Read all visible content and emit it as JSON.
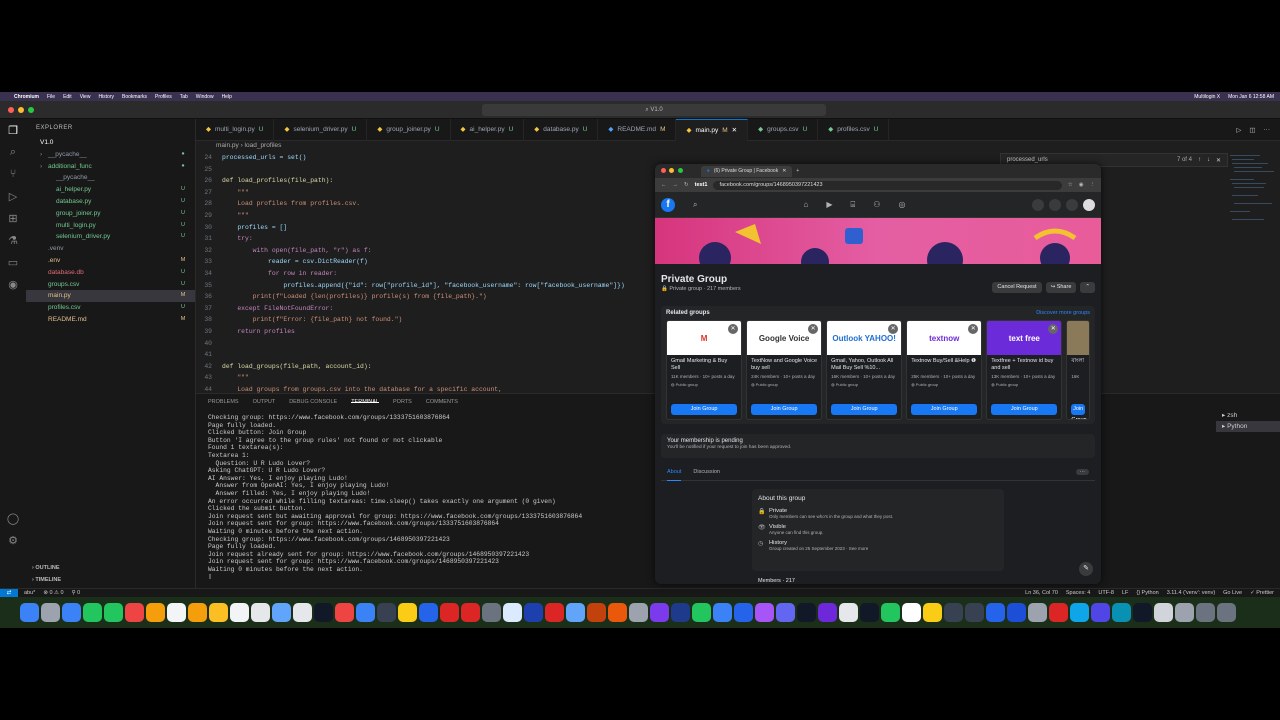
{
  "menubar": {
    "app": "Chromium",
    "items": [
      "File",
      "Edit",
      "View",
      "History",
      "Bookmarks",
      "Profiles",
      "Tab",
      "Window",
      "Help"
    ],
    "right": [
      "Multilogin X",
      "Mon Jan 6  12:58 AM"
    ]
  },
  "vscode": {
    "command_center": "V1.0",
    "explorer_title": "EXPLORER",
    "tree": [
      {
        "name": "V1.0",
        "indent": 0,
        "color": "#ffffff",
        "flag": "",
        "flag_color": "#888"
      },
      {
        "name": "__pycache__",
        "indent": 1,
        "color": "#8e9aa8",
        "flag": "●",
        "flag_color": "#73c991"
      },
      {
        "name": "additional_func",
        "indent": 1,
        "color": "#73c991",
        "flag": "●",
        "flag_color": "#73c991"
      },
      {
        "name": "__pycache__",
        "indent": 2,
        "color": "#8e9aa8",
        "flag": "",
        "flag_color": "#888"
      },
      {
        "name": "ai_helper.py",
        "indent": 2,
        "color": "#73c991",
        "flag": "U",
        "flag_color": "#73c991"
      },
      {
        "name": "database.py",
        "indent": 2,
        "color": "#73c991",
        "flag": "U",
        "flag_color": "#73c991"
      },
      {
        "name": "group_joiner.py",
        "indent": 2,
        "color": "#73c991",
        "flag": "U",
        "flag_color": "#73c991"
      },
      {
        "name": "multi_login.py",
        "indent": 2,
        "color": "#73c991",
        "flag": "U",
        "flag_color": "#73c991"
      },
      {
        "name": "selenium_driver.py",
        "indent": 2,
        "color": "#73c991",
        "flag": "U",
        "flag_color": "#73c991"
      },
      {
        "name": ".venv",
        "indent": 1,
        "color": "#8e9aa8",
        "flag": "",
        "flag_color": "#888"
      },
      {
        "name": ".env",
        "indent": 1,
        "color": "#e2c08d",
        "flag": "M",
        "flag_color": "#e2c08d"
      },
      {
        "name": "database.db",
        "indent": 1,
        "color": "#e06c75",
        "flag": "U",
        "flag_color": "#73c991"
      },
      {
        "name": "groups.csv",
        "indent": 1,
        "color": "#73c991",
        "flag": "U",
        "flag_color": "#73c991"
      },
      {
        "name": "main.py",
        "indent": 1,
        "color": "#e2c08d",
        "flag": "M",
        "flag_color": "#e2c08d",
        "selected": true
      },
      {
        "name": "profiles.csv",
        "indent": 1,
        "color": "#73c991",
        "flag": "U",
        "flag_color": "#73c991"
      },
      {
        "name": "README.md",
        "indent": 1,
        "color": "#e2c08d",
        "flag": "M",
        "flag_color": "#e2c08d"
      }
    ],
    "outline": "OUTLINE",
    "timeline": "TIMELINE",
    "tabs": [
      {
        "label": "multi_login.py",
        "flag": "U",
        "active": false
      },
      {
        "label": "selenium_driver.py",
        "flag": "U",
        "active": false
      },
      {
        "label": "group_joiner.py",
        "flag": "U",
        "active": false
      },
      {
        "label": "ai_helper.py",
        "flag": "U",
        "active": false
      },
      {
        "label": "database.py",
        "flag": "U",
        "active": false
      },
      {
        "label": "README.md",
        "flag": "M",
        "active": false
      },
      {
        "label": "main.py",
        "flag": "M",
        "active": true
      },
      {
        "label": "groups.csv",
        "flag": "U",
        "active": false
      },
      {
        "label": "profiles.csv",
        "flag": "U",
        "active": false
      }
    ],
    "breadcrumb": "main.py  ›  load_profiles",
    "find": {
      "query": "processed_urls",
      "count": "7 of 4"
    },
    "code": [
      {
        "n": "24",
        "t": "processed_urls = set()"
      },
      {
        "n": "25",
        "t": ""
      },
      {
        "n": "26",
        "t": "def load_profiles(file_path):"
      },
      {
        "n": "27",
        "t": "    \"\"\""
      },
      {
        "n": "28",
        "t": "    Load profiles from profiles.csv."
      },
      {
        "n": "29",
        "t": "    \"\"\""
      },
      {
        "n": "30",
        "t": "    profiles = []"
      },
      {
        "n": "31",
        "t": "    try:"
      },
      {
        "n": "32",
        "t": "        with open(file_path, \"r\") as f:"
      },
      {
        "n": "33",
        "t": "            reader = csv.DictReader(f)"
      },
      {
        "n": "34",
        "t": "            for row in reader:"
      },
      {
        "n": "35",
        "t": "                profiles.append({\"id\": row[\"profile_id\"], \"facebook_username\": row[\"facebook_username\"]})"
      },
      {
        "n": "36",
        "t": "        print(f\"Loaded {len(profiles)} profile(s) from {file_path}.\")"
      },
      {
        "n": "37",
        "t": "    except FileNotFoundError:"
      },
      {
        "n": "38",
        "t": "        print(f\"Error: {file_path} not found.\")"
      },
      {
        "n": "39",
        "t": "    return profiles"
      },
      {
        "n": "40",
        "t": ""
      },
      {
        "n": "41",
        "t": ""
      },
      {
        "n": "42",
        "t": "def load_groups(file_path, account_id):"
      },
      {
        "n": "43",
        "t": "    \"\"\""
      },
      {
        "n": "44",
        "t": "    Load groups from groups.csv into the database for a specific account,"
      },
      {
        "n": "45",
        "t": "    skipping those already present in the database."
      },
      {
        "n": "46",
        "t": "    \"\"\""
      },
      {
        "n": "47",
        "t": "    try:"
      },
      {
        "n": "48",
        "t": "        existing_groups = set(row[\"group_url\"] for row in get_account_groups(account_id))"
      }
    ],
    "panel_tabs": [
      "PROBLEMS",
      "OUTPUT",
      "DEBUG CONSOLE",
      "TERMINAL",
      "PORTS",
      "COMMENTS"
    ],
    "terminal": [
      "Checking group: https://www.facebook.com/groups/1333751603876864",
      "Page fully loaded.",
      "Clicked button: Join Group",
      "Button 'I agree to the group rules' not found or not clickable",
      "Found 1 textarea(s):",
      "Textarea 1:",
      "  Question: U R Ludo Lover?",
      "Asking ChatGPT: U R Ludo Lover?",
      "AI Answer: Yes, I enjoy playing Ludo!",
      "  Answer from OpenAI: Yes, I enjoy playing Ludo!",
      "  Answer filled: Yes, I enjoy playing Ludo!",
      "An error occurred while filling textareas: time.sleep() takes exactly one argument (0 given)",
      "Clicked the submit button.",
      "Join request sent but awaiting approval for group: https://www.facebook.com/groups/1333751603876864",
      "Join request sent for group: https://www.facebook.com/groups/1333751603876864",
      "Waiting 0 minutes before the next action.",
      "Checking group: https://www.facebook.com/groups/1468950397221423",
      "Page fully loaded.",
      "Join request already sent for group: https://www.facebook.com/groups/1468950397221423",
      "Join request sent for group: https://www.facebook.com/groups/1468950397221423",
      "Waiting 0 minutes before the next action."
    ],
    "terminals": [
      "zsh",
      "Python"
    ],
    "status": {
      "branch": "abu*",
      "errors": "⊗ 0 ⚠ 0",
      "ports": "⚲ 0",
      "cursor": "Ln 36, Col 70",
      "spaces": "Spaces: 4",
      "encoding": "UTF-8",
      "eol": "LF",
      "lang": "{} Python",
      "interp": "3.11.4 ('venv': venv)",
      "golive": "Go Live",
      "prettier": "✓ Prettier"
    }
  },
  "chrome": {
    "tab_title": "(6) Private Group | Facebook",
    "profile": "test1",
    "url": "facebook.com/groups/1468950397221423"
  },
  "facebook": {
    "group_name": "Private Group",
    "group_sub": "🔒 Private group · 217 members",
    "cancel": "Cancel Request",
    "share": "Share",
    "related_title": "Related groups",
    "discover": "Discover more groups",
    "cards": [
      {
        "title": "Gmail Marketing & Buy Sell",
        "meta": "11K members · 10+ posts a day",
        "img": "M",
        "bg": "#ffffff",
        "fg": "#d93025"
      },
      {
        "title": "TextNow and Google Voice buy sell",
        "meta": "24K members · 10+ posts a day",
        "img": "Google Voice",
        "bg": "#ffffff",
        "fg": "#333333"
      },
      {
        "title": "Gmail, Yahoo, Outlook All Mail Buy Sell %10...",
        "meta": "16K members · 10+ posts a day",
        "img": "Outlook YAHOO!",
        "bg": "#ffffff",
        "fg": "#1f6fd1"
      },
      {
        "title": "Textnow Buy/Sell &Help ❶",
        "meta": "25K members · 10+ posts a day",
        "img": "textnow",
        "bg": "#ffffff",
        "fg": "#6c2bd9"
      },
      {
        "title": "Textfree + Textnow id buy and sell",
        "meta": "13K members · 10+ posts a day",
        "img": "text free",
        "bg": "#6c2bd9",
        "fg": "#ffffff"
      },
      {
        "title": "বাংলা",
        "meta": "16K",
        "img": "",
        "bg": "#8a7a5a",
        "fg": "#ffffff"
      }
    ],
    "public_label": "Public group",
    "join_label": "Join Group",
    "pending_title": "Your membership is pending",
    "pending_sub": "You'll be notified if your request to join has been approved.",
    "tabs": [
      "About",
      "Discussion"
    ],
    "about_title": "About this group",
    "about": [
      {
        "icon": "🔒",
        "h": "Private",
        "d": "Only members can see who's in the group and what they post."
      },
      {
        "icon": "👁",
        "h": "Visible",
        "d": "Anyone can find this group."
      },
      {
        "icon": "◷",
        "h": "History",
        "d": "Group created on 25 September 2023 · See more"
      }
    ],
    "members_peek": "Members · 217"
  }
}
